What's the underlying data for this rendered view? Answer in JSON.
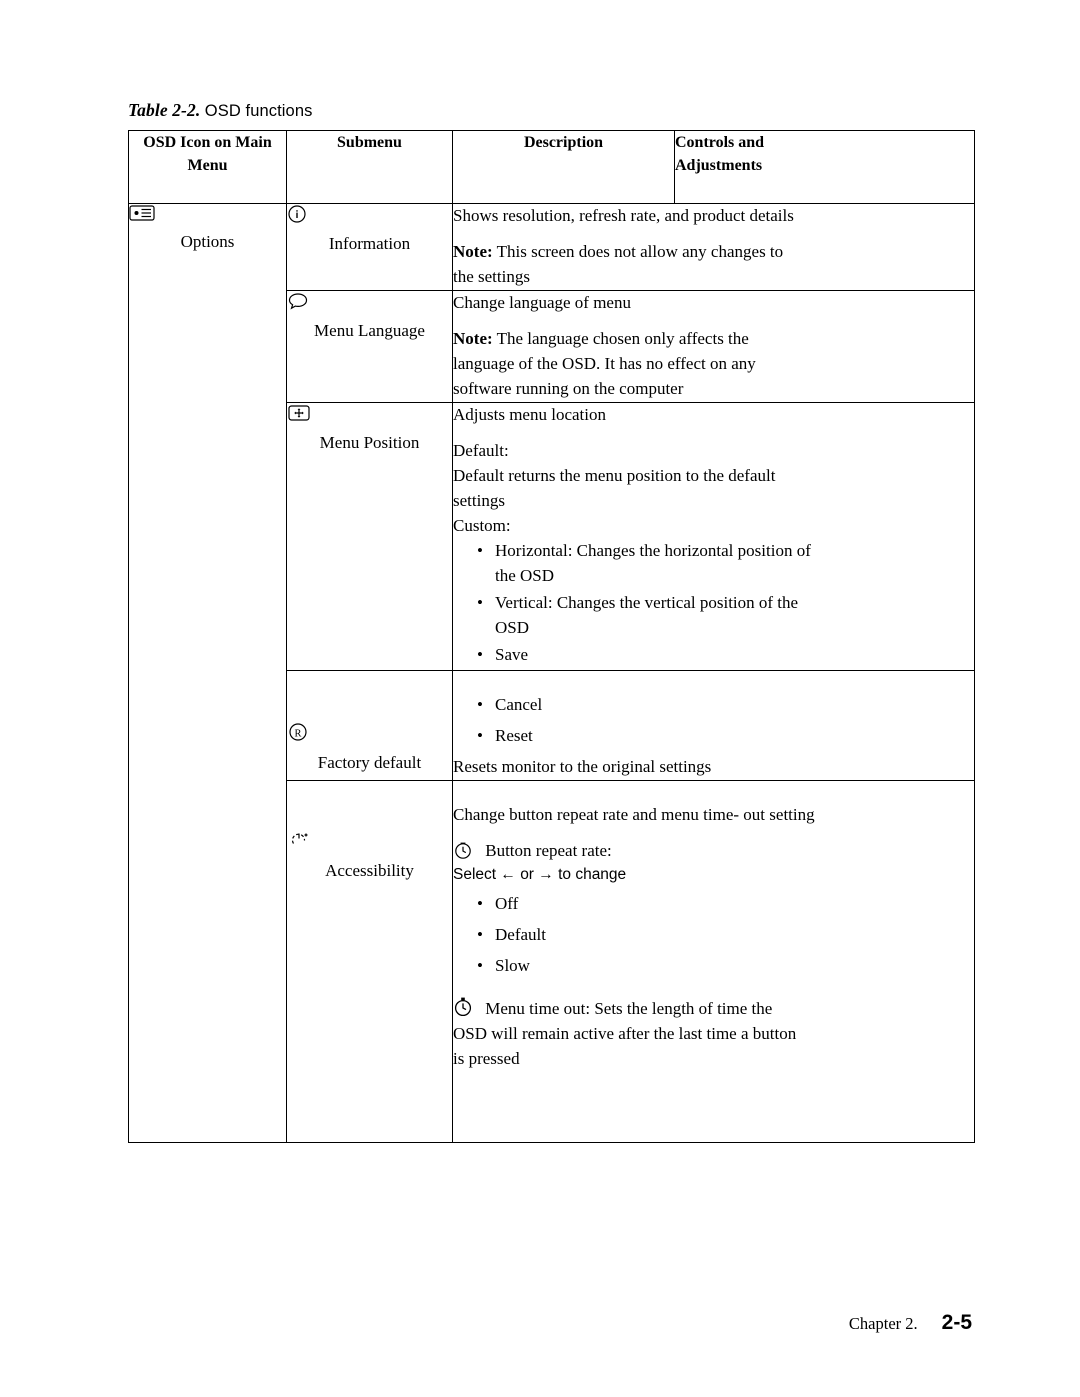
{
  "caption": {
    "prefix": "Table 2-2.",
    "text": "OSD functions"
  },
  "table": {
    "headers": [
      "OSD Icon on Main Menu",
      "Submenu",
      "Description",
      "Controls and Adjustments"
    ],
    "header_parts": {
      "col1_line1": "OSD Icon on Main",
      "col1_line2": "Menu",
      "col2": "Submenu",
      "col3": "Description",
      "col4_line1": "Controls and",
      "col4_line2": "Adjustments"
    },
    "main_menu": {
      "label": "Options",
      "icon": "options-icon"
    },
    "rows": [
      {
        "submenu_label": "Information",
        "submenu_icon": "information-icon",
        "desc_line1": "Shows resolution, refresh rate, and product details",
        "desc_note_bold": "Note:",
        "desc_note_rest": " This screen does not allow any changes to",
        "desc_note_line2": "the settings"
      },
      {
        "submenu_label": "Menu Language",
        "submenu_icon": "speech-bubble-icon",
        "desc_line1": "Change language of menu",
        "desc_note_bold": "Note:",
        "desc_note_rest": " The language chosen only affects the",
        "desc_note_line2": "language of the OSD. It has no effect on any",
        "desc_note_line3": "software running on the computer"
      },
      {
        "submenu_label": "Menu Position",
        "submenu_icon": "menu-position-icon",
        "desc_line1": "Adjusts menu location",
        "desc_default_label": "Default:",
        "desc_default_line1": "Default returns the menu position to the default",
        "desc_default_line2": "settings",
        "desc_custom_label": "Custom:",
        "bullets": [
          "Horizontal: Changes the horizontal position of the OSD",
          "Vertical: Changes the vertical position of the OSD",
          "Save"
        ],
        "bullet_parts": [
          {
            "l1": "Horizontal: Changes the horizontal position of",
            "l2": "the OSD"
          },
          {
            "l1": "Vertical: Changes the vertical position of the",
            "l2": "OSD"
          },
          {
            "l1": "Save",
            "l2": ""
          }
        ]
      },
      {
        "submenu_label": "Factory default",
        "submenu_icon": "factory-default-icon",
        "bullets": [
          "Cancel",
          "Reset"
        ],
        "desc_line_after": "Resets monitor to the original settings"
      },
      {
        "submenu_label": "Accessibility",
        "submenu_icon": "accessibility-icon",
        "desc_line1": "Change button repeat rate and menu time- out setting",
        "repeat_icon": "clock-icon",
        "repeat_label": "Button repeat rate:",
        "repeat_select": "Select ← or → to change",
        "bullets": [
          "Off",
          "Default",
          "Slow"
        ],
        "timeout_icon": "stopwatch-icon",
        "timeout_line1": "Menu time out: Sets the length of time the",
        "timeout_line2": "OSD will remain active after the last time a button",
        "timeout_line3": "is pressed"
      }
    ]
  },
  "footer": {
    "chapter": "Chapter 2.",
    "page": "2-5"
  }
}
